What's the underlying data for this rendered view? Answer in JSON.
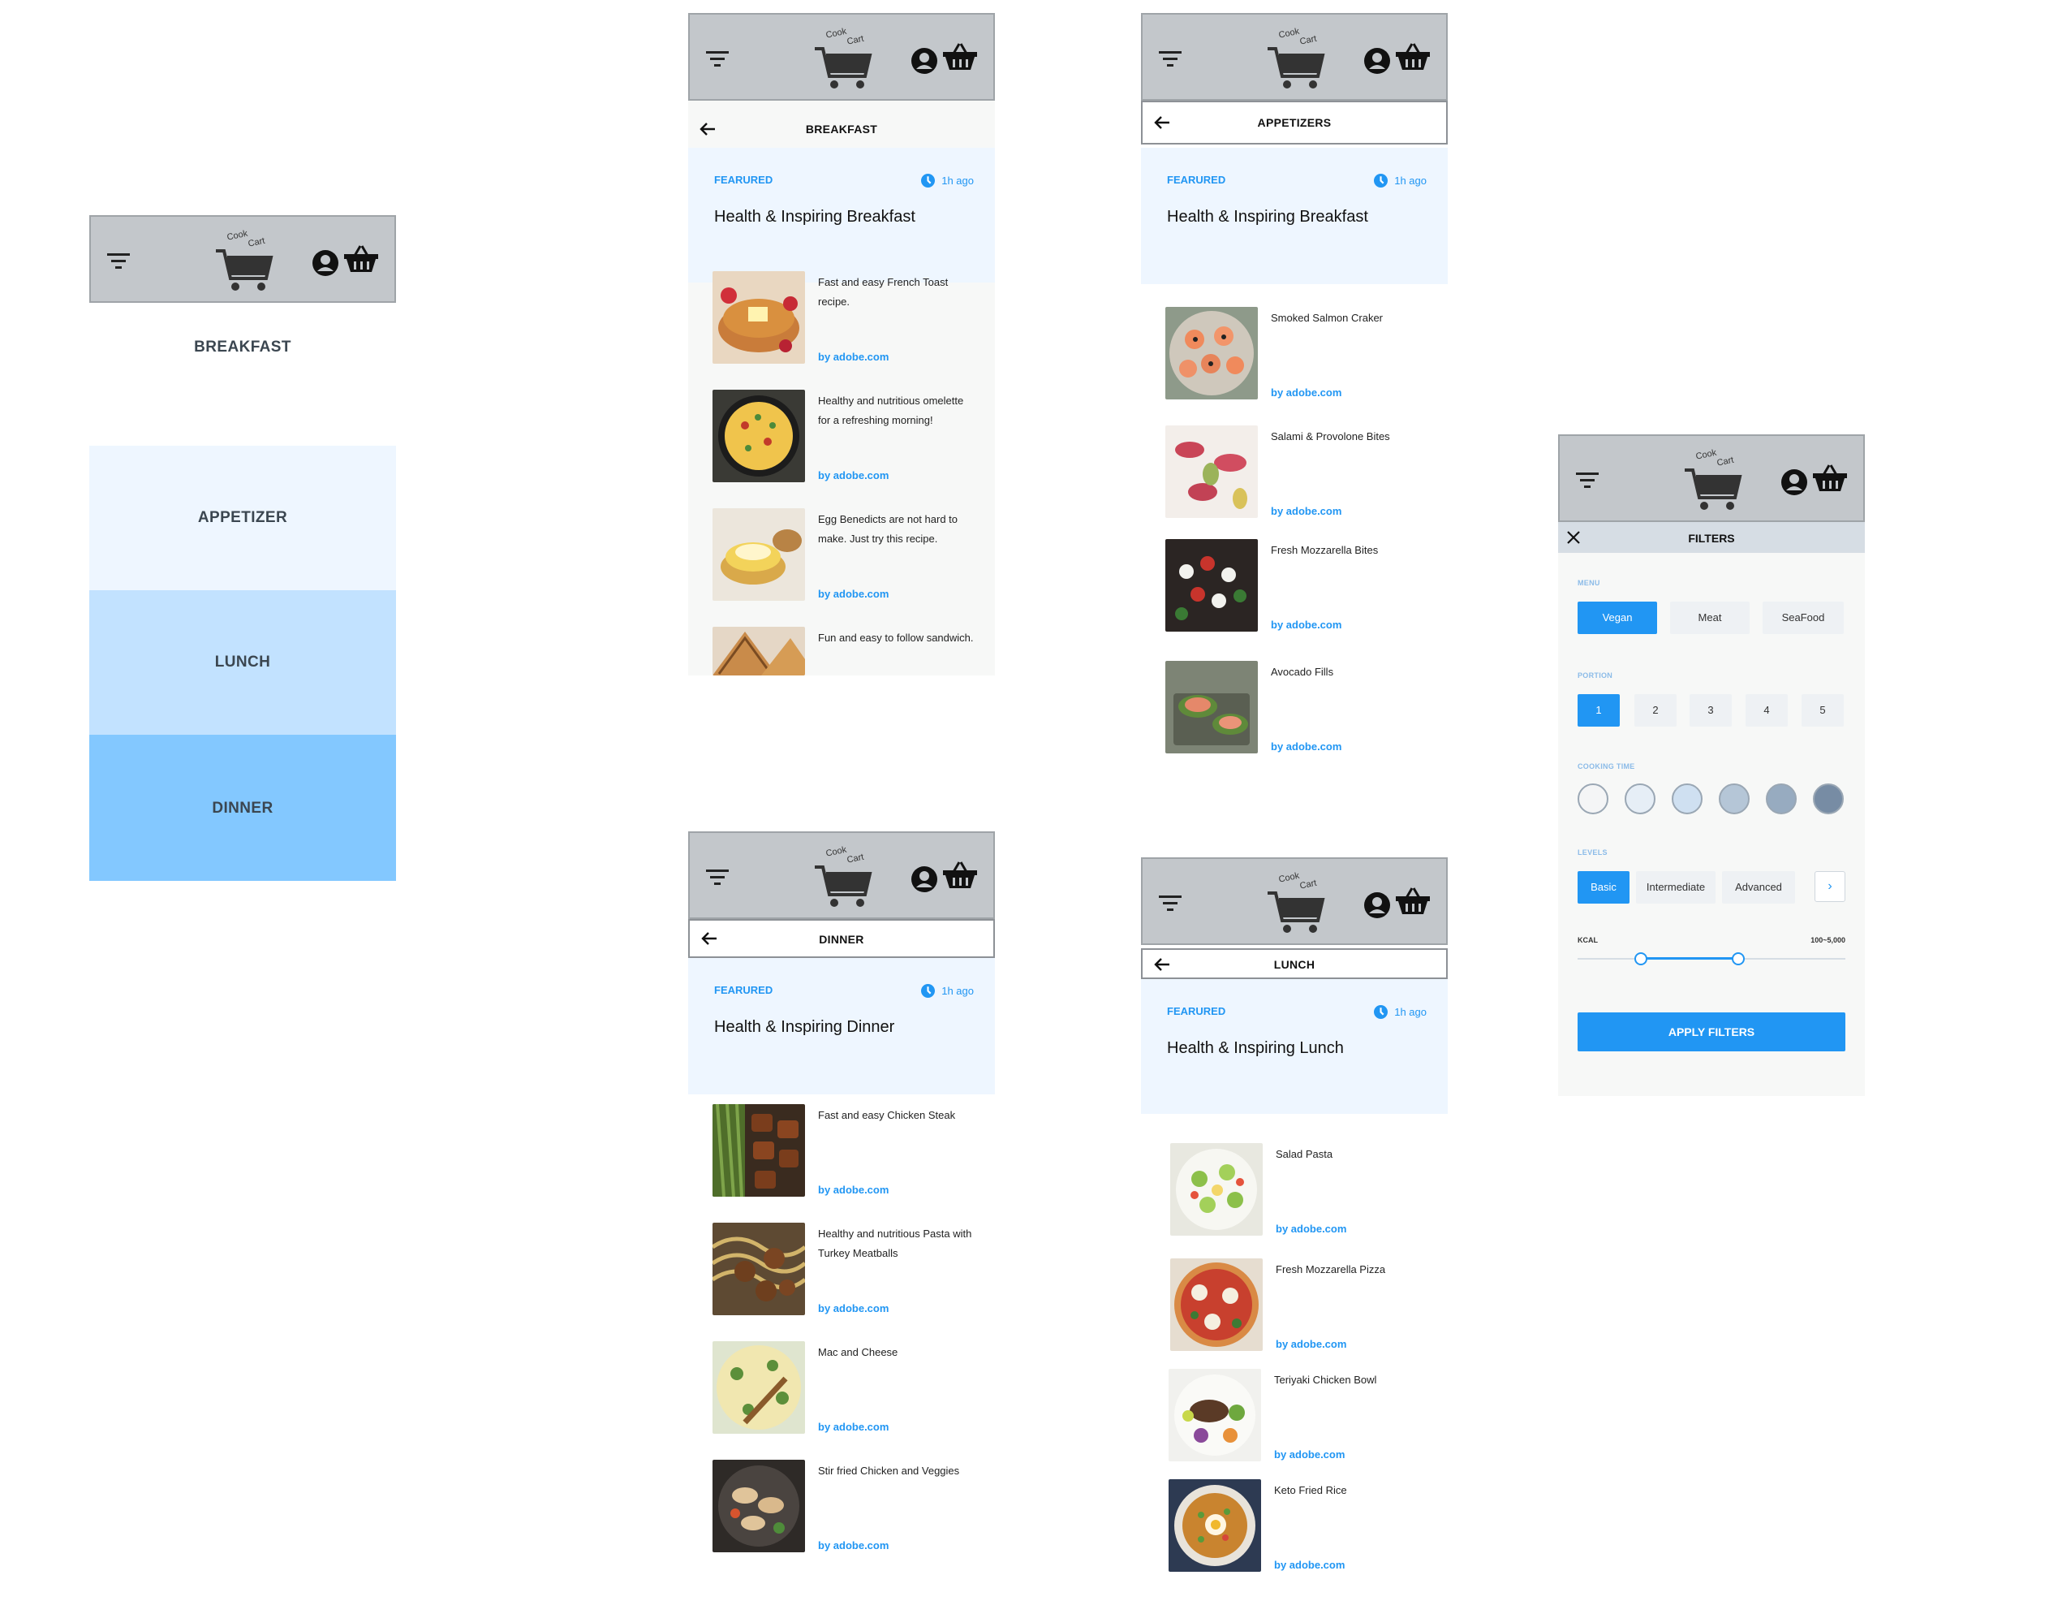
{
  "brand": {
    "logo_text_top": "Cook",
    "logo_text_bottom": "Cart"
  },
  "menu_screen": {
    "categories": [
      "BREAKFAST",
      "APPETIZER",
      "LUNCH",
      "DINNER"
    ]
  },
  "breakfast": {
    "title": "BREAKFAST",
    "featured_tag": "FEARURED",
    "time": "1h ago",
    "headline": "Health & Inspiring Breakfast",
    "items": [
      {
        "desc": "Fast and easy French Toast recipe.",
        "src": "by adobe.com"
      },
      {
        "desc": "Healthy and nutritious omelette for a refreshing morning!",
        "src": "by adobe.com"
      },
      {
        "desc": "Egg Benedicts are not hard to make. Just try this recipe.",
        "src": "by adobe.com"
      },
      {
        "desc": "Fun and easy to follow sandwich.",
        "src": ""
      }
    ]
  },
  "appetizers": {
    "title": "APPETIZERS",
    "featured_tag": "FEARURED",
    "time": "1h ago",
    "headline": "Health & Inspiring Breakfast",
    "items": [
      {
        "desc": "Smoked Salmon Craker",
        "src": "by adobe.com"
      },
      {
        "desc": "Salami & Provolone Bites",
        "src": "by adobe.com"
      },
      {
        "desc": "Fresh Mozzarella Bites",
        "src": "by adobe.com"
      },
      {
        "desc": "Avocado Fills",
        "src": "by adobe.com"
      }
    ]
  },
  "dinner": {
    "title": "DINNER",
    "featured_tag": "FEARURED",
    "time": "1h ago",
    "headline": "Health & Inspiring Dinner",
    "items": [
      {
        "desc": "Fast and easy Chicken Steak",
        "src": "by adobe.com"
      },
      {
        "desc": "Healthy and nutritious Pasta with Turkey Meatballs",
        "src": "by adobe.com"
      },
      {
        "desc": "Mac and Cheese",
        "src": "by adobe.com"
      },
      {
        "desc": "Stir fried Chicken and Veggies",
        "src": "by adobe.com"
      }
    ]
  },
  "lunch": {
    "title": "LUNCH",
    "featured_tag": "FEARURED",
    "time": "1h ago",
    "headline": "Health & Inspiring Lunch",
    "items": [
      {
        "desc": "Salad Pasta",
        "src": "by adobe.com"
      },
      {
        "desc": "Fresh Mozzarella Pizza",
        "src": "by adobe.com"
      },
      {
        "desc": "Teriyaki Chicken Bowl",
        "src": "by adobe.com"
      },
      {
        "desc": "Keto Fried Rice",
        "src": "by adobe.com"
      }
    ]
  },
  "filters": {
    "title": "FILTERS",
    "menu_label": "MENU",
    "menu_options": [
      "Vegan",
      "Meat",
      "SeaFood"
    ],
    "menu_selected": "Vegan",
    "portion_label": "PORTION",
    "portions": [
      "1",
      "2",
      "3",
      "4",
      "5"
    ],
    "portion_selected": "1",
    "cooking_time_label": "COOKING TIME",
    "level_label": "LEVELS",
    "levels": [
      "Basic",
      "Intermediate",
      "Advanced"
    ],
    "level_selected": "Basic",
    "next_glyph": "›",
    "kcal_label": "KCAL",
    "kcal_range": "100~5,000",
    "apply_label": "APPLY FILTERS"
  },
  "colors": {
    "accent": "#2196f3",
    "header_gray": "#c3c7cb",
    "featured_bg": "#eef6ff",
    "appetizer_bg": "#eef6ff",
    "lunch_bg": "#c2e2ff",
    "dinner_bg": "#83c8ff"
  }
}
